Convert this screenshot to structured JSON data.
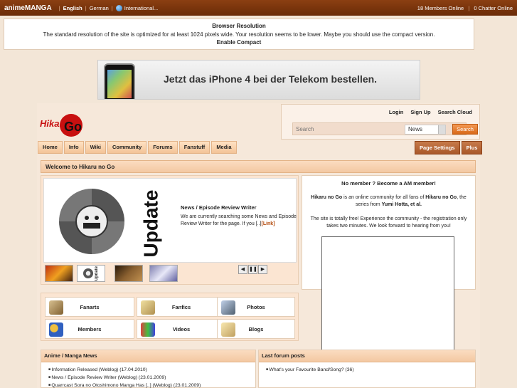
{
  "topbar": {
    "brand": "animeMANGA",
    "lang_english": "English",
    "lang_german": "German",
    "lang_international": "International...",
    "members_online": "18 Members Online",
    "chatter_online": "0 Chatter Online"
  },
  "resolution": {
    "title": "Browser Resolution",
    "message": "The standard resolution of the site is optimized for at least 1024 pixels wide. Your resolution seems to be lower. Maybe you should use the compact version.",
    "compact_link": "Enable Compact"
  },
  "banner": {
    "text": "Jetzt das iPhone 4 bei der Telekom bestellen."
  },
  "header": {
    "login": "Login",
    "signup": "Sign Up",
    "search_cloud": "Search Cloud",
    "search_placeholder": "Search",
    "search_select": "News",
    "search_button": "Search"
  },
  "nav": {
    "items": [
      "Home",
      "Info",
      "Wiki",
      "Community",
      "Forums",
      "Fanstuff",
      "Media"
    ],
    "page_settings": "Page Settings",
    "plus": "Plus"
  },
  "welcome": {
    "title": "Welcome to Hikaru no Go"
  },
  "slider": {
    "update_word": "Update",
    "news_title": "News / Episode Review Writer",
    "news_body": "We are currently searching some News and Episode Review Writer for the page. If you [..]",
    "news_link": "[Link]",
    "thumb_update": "Update"
  },
  "member": {
    "heading": "No member ? Become a AM member!",
    "line1_a": "Hikaru no Go",
    "line1_b": " is an online community for all fans of ",
    "line1_c": "Hikaru no Go",
    "line1_d": ", the series from ",
    "line1_e": "Yumi Hotta, et al.",
    "line2": "The site is totally free! Experience the community - the registration only takes two minutes. We look forward to hearing from you!"
  },
  "grid": {
    "fanarts": "Fanarts",
    "fanfics": "Fanfics",
    "photos": "Photos",
    "members": "Members",
    "videos": "Videos",
    "blogs": "Blogs"
  },
  "news_box": {
    "title": "Anime / Manga News",
    "items": [
      "Information Released (Weblog) (17.04.2010)",
      "News / Episode Review Writer (Weblog) (23.01.2009)",
      "Quarrcast Sora no Otoshimono Manga Has [..] (Weblog) (23.01.2009)"
    ]
  },
  "forum_box": {
    "title": "Last forum posts",
    "items": [
      "What's your Favourite Band/Song? (36)"
    ]
  }
}
